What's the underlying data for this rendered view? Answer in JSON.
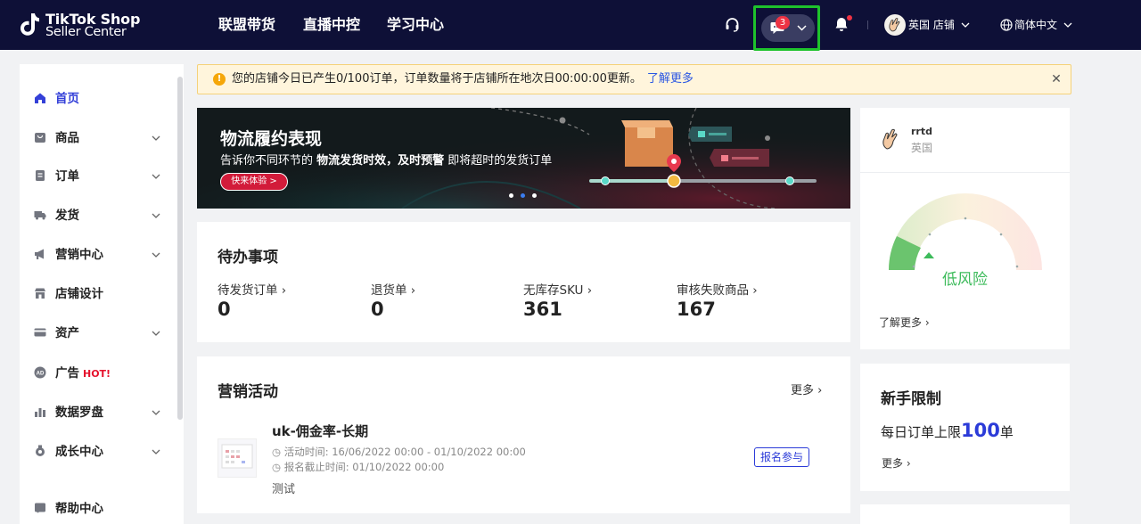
{
  "header": {
    "logo_line1": "TikTok Shop",
    "logo_line2": "Seller Center",
    "nav": [
      "联盟带货",
      "直播中控",
      "学习中心"
    ],
    "chat_badge": "3",
    "shop_label": "英国 店铺",
    "lang_label": "简体中文"
  },
  "sidebar": {
    "items": [
      {
        "label": "首页",
        "icon": "home-icon"
      },
      {
        "label": "商品",
        "icon": "product-icon"
      },
      {
        "label": "订单",
        "icon": "order-icon"
      },
      {
        "label": "发货",
        "icon": "truck-icon"
      },
      {
        "label": "营销中心",
        "icon": "megaphone-icon"
      },
      {
        "label": "店铺设计",
        "icon": "store-icon"
      },
      {
        "label": "资产",
        "icon": "card-icon"
      },
      {
        "label": "广告",
        "icon": "ad-icon",
        "badge": "HOT!"
      },
      {
        "label": "数据罗盘",
        "icon": "chart-icon"
      },
      {
        "label": "成长中心",
        "icon": "medal-icon"
      },
      {
        "label": "帮助中心",
        "icon": "help-icon"
      }
    ]
  },
  "notice": {
    "text": "您的店铺今日已产生0/100订单，订单数量将于店铺所在地次日00:00:00更新。",
    "link": "了解更多"
  },
  "banner": {
    "title": "物流履约表现",
    "sub_prefix": "告诉你不同环节的 ",
    "sub_bold": "物流发货时效，及时预警",
    "sub_suffix": " 即将超时的发货订单",
    "button": "快来体验 >"
  },
  "todo": {
    "title": "待办事项",
    "stats": [
      {
        "label": "待发货订单",
        "value": "0"
      },
      {
        "label": "退货单",
        "value": "0"
      },
      {
        "label": "无库存SKU",
        "value": "361"
      },
      {
        "label": "审核失败商品",
        "value": "167"
      }
    ]
  },
  "marketing": {
    "title": "营销活动",
    "more": "更多",
    "activity": {
      "title": "uk-佣金率-长期",
      "time": "活动时间: 16/06/2022 00:00 - 01/10/2022 00:00",
      "deadline": "报名截止时间: 01/10/2022 00:00",
      "desc": "测试",
      "join": "报名参与"
    }
  },
  "shop_card": {
    "name": "rrtd",
    "region": "英国",
    "risk_label": "低风险",
    "learn_more": "了解更多"
  },
  "newbie": {
    "title": "新手限制",
    "limit_prefix": "每日订单上限",
    "limit_value": "100",
    "limit_suffix": "单",
    "more": "更多"
  },
  "colors": {
    "topbar": "#0e1037",
    "accent": "#2b3bd8",
    "highlight": "#1ec22c",
    "risk": "#3dbb5b",
    "hot": "#e5122d"
  }
}
